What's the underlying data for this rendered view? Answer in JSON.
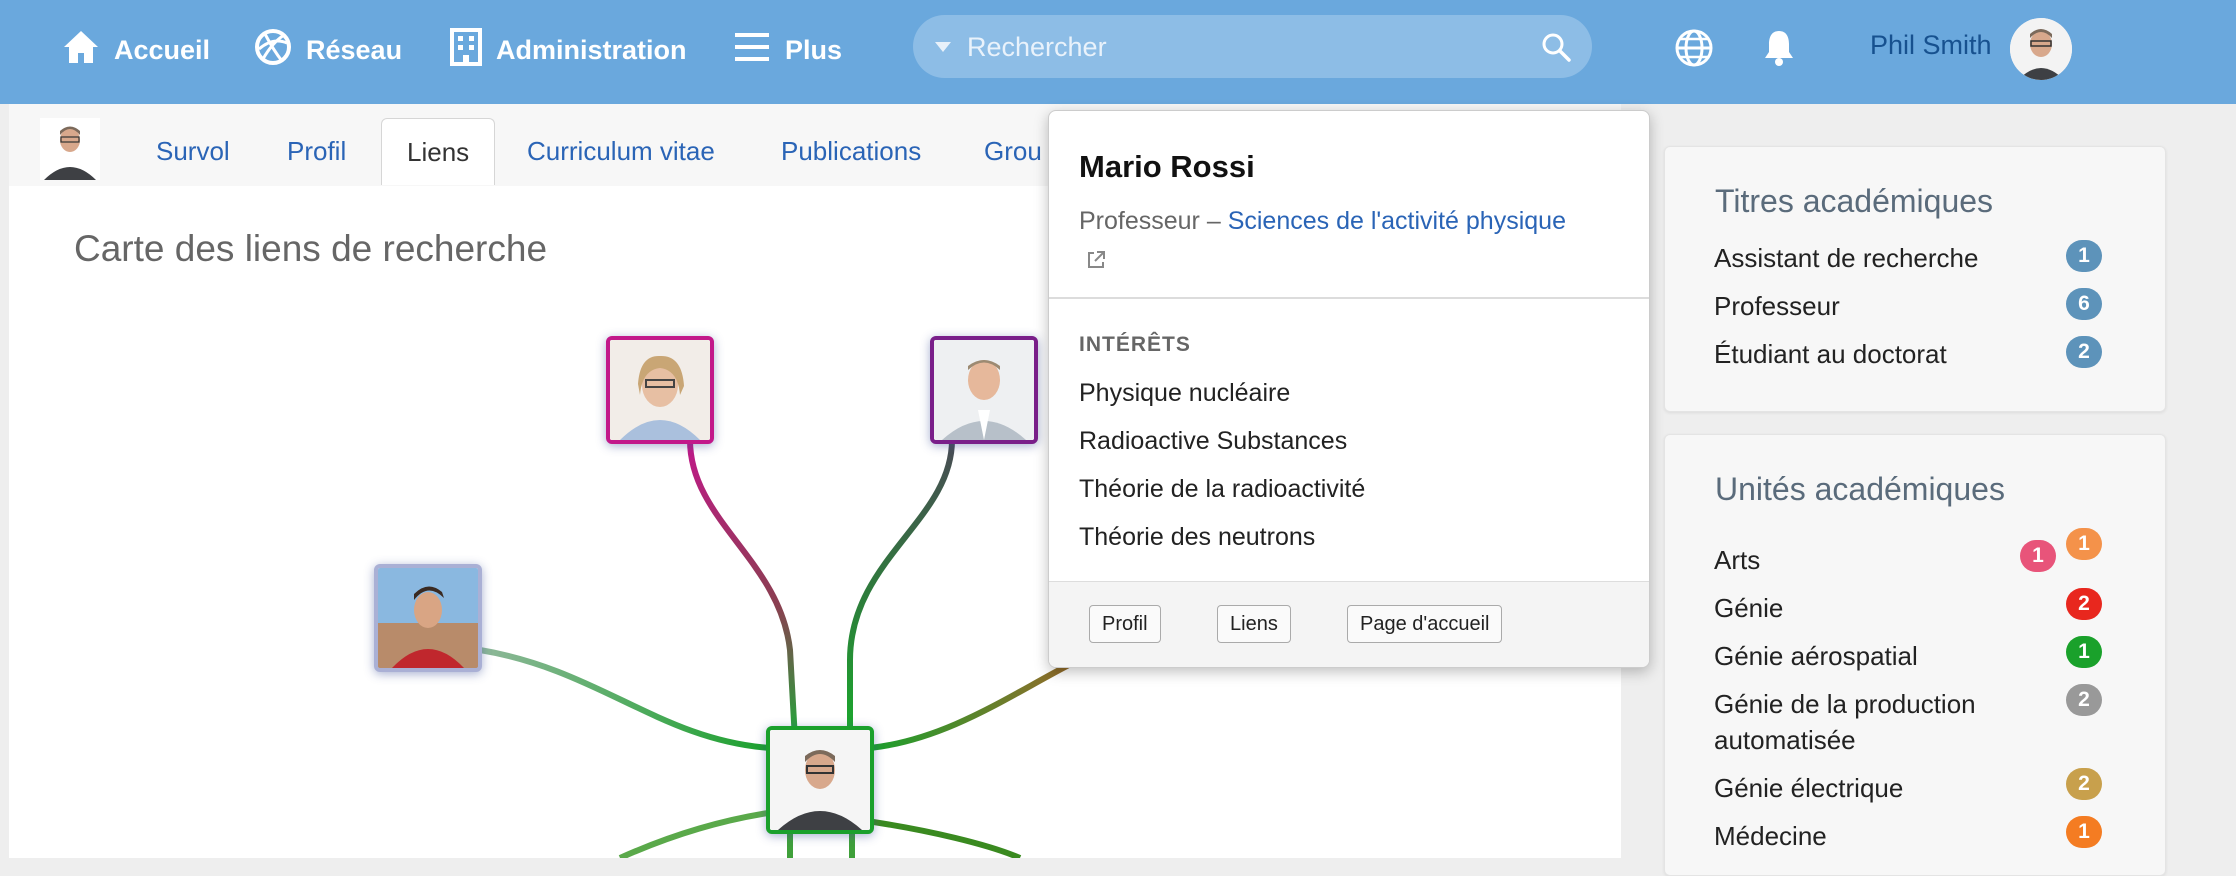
{
  "topnav": {
    "home_label": "Accueil",
    "network_label": "Réseau",
    "admin_label": "Administration",
    "more_label": "Plus",
    "search_placeholder": "Rechercher",
    "user_name": "Phil Smith"
  },
  "tabs": [
    "Survol",
    "Profil",
    "Liens",
    "Curriculum vitae",
    "Publications",
    "Grou"
  ],
  "active_tab": "Liens",
  "page_heading": "Carte des liens de recherche",
  "popup": {
    "name": "Mario Rossi",
    "role_prefix": "Professeur – ",
    "department": "Sciences de l'activité physique",
    "interests_label": "INTÉRÊTS",
    "interests": [
      "Physique nucléaire",
      "Radioactive Substances",
      "Théorie de la radioactivité",
      "Théorie des neutrons"
    ],
    "buttons": [
      "Profil",
      "Liens",
      "Page d'accueil"
    ]
  },
  "academic_titles": {
    "title": "Titres académiques",
    "items": [
      {
        "label": "Assistant de recherche",
        "count": "1",
        "color": "#5d93ba"
      },
      {
        "label": "Professeur",
        "count": "6",
        "color": "#5d93ba"
      },
      {
        "label": "Étudiant au doctorat",
        "count": "2",
        "color": "#5d93ba"
      }
    ]
  },
  "academic_units": {
    "title": "Unités académiques",
    "items": [
      {
        "label": "Arts",
        "badges": [
          {
            "count": "1",
            "color": "#e8547a"
          },
          {
            "count": "1",
            "color": "#f4924a"
          }
        ]
      },
      {
        "label": "Génie",
        "badges": [
          {
            "count": "2",
            "color": "#e8271e"
          }
        ]
      },
      {
        "label": "Génie aérospatial",
        "badges": [
          {
            "count": "1",
            "color": "#1aa12b"
          }
        ]
      },
      {
        "label": "Génie de la production automatisée",
        "badges": [
          {
            "count": "2",
            "color": "#999999"
          }
        ]
      },
      {
        "label": "Génie électrique",
        "badges": [
          {
            "count": "2",
            "color": "#c8a04c"
          }
        ]
      },
      {
        "label": "Médecine",
        "badges": [
          {
            "count": "1",
            "color": "#f47c22"
          }
        ]
      }
    ]
  }
}
